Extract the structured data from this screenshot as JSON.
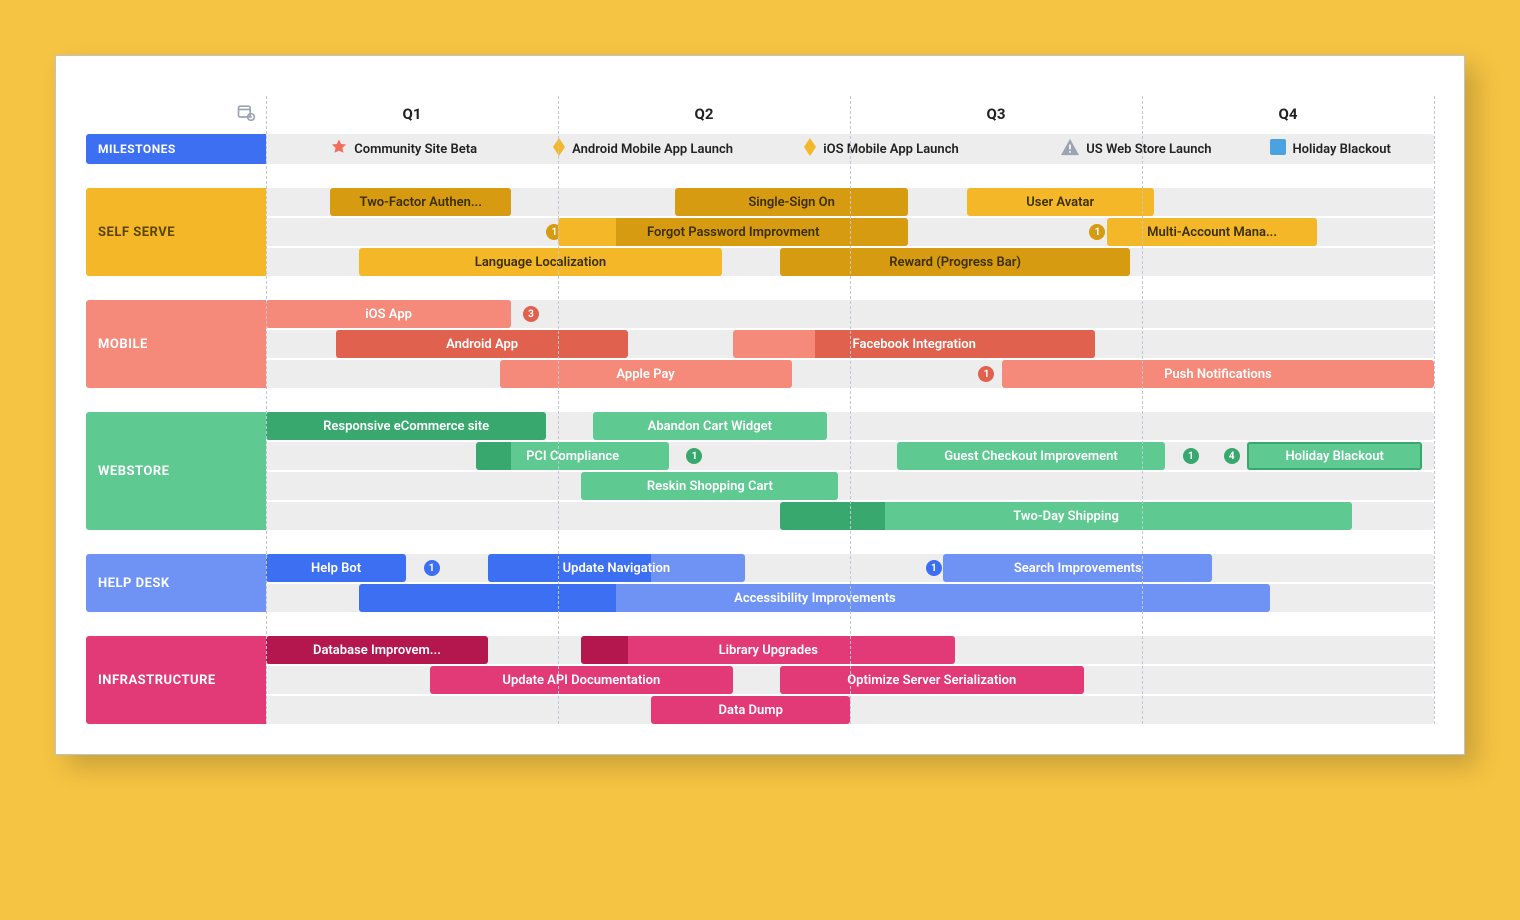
{
  "quarters": [
    "Q1",
    "Q2",
    "Q3",
    "Q4"
  ],
  "milestones_label": "MILESTONES",
  "milestones": [
    {
      "label": "Community Site Beta",
      "icon": "star",
      "pos": 5.5
    },
    {
      "label": "Android Mobile App Launch",
      "icon": "diamond",
      "pos": 24.5
    },
    {
      "label": "iOS Mobile App Launch",
      "icon": "diamond",
      "pos": 46
    },
    {
      "label": "US Web Store Launch",
      "icon": "warn",
      "pos": 68
    },
    {
      "label": "Holiday Blackout",
      "icon": "square",
      "pos": 86
    }
  ],
  "categories": [
    {
      "key": "ss",
      "label": "SELF SERVE",
      "class": "cat-ss",
      "lanes": [
        [
          {
            "label": "Two-Factor Authen...",
            "start": 5.5,
            "end": 21,
            "variant": "d",
            "text": "t-dark"
          },
          {
            "label": "Single-Sign On",
            "start": 35,
            "end": 55,
            "variant": "d",
            "text": "t-dark"
          },
          {
            "label": "User Avatar",
            "start": 60,
            "end": 76,
            "variant": "",
            "text": "t-dark"
          }
        ],
        [
          {
            "badge": "1",
            "at": 24,
            "bcolor": "#d69b10"
          },
          {
            "label": "Forgot Password Improvment",
            "start": 25,
            "end": 55,
            "variant": "d",
            "text": "t-dark",
            "prefill": {
              "start": 25,
              "end": 30,
              "color": "#f4b728"
            }
          },
          {
            "badge": "1",
            "at": 70.5,
            "bcolor": "#d69b10"
          },
          {
            "label": "Multi-Account Mana...",
            "start": 72,
            "end": 90,
            "variant": "",
            "text": "t-dark"
          }
        ],
        [
          {
            "label": "Language Localization",
            "start": 8,
            "end": 39,
            "variant": "",
            "text": "t-dark"
          },
          {
            "label": "Reward (Progress Bar)",
            "start": 44,
            "end": 74,
            "variant": "d",
            "text": "t-dark"
          }
        ]
      ]
    },
    {
      "key": "mb",
      "label": "MOBILE",
      "class": "cat-mb",
      "lanes": [
        [
          {
            "label": "iOS App",
            "start": 0,
            "end": 21,
            "variant": "",
            "text": ""
          },
          {
            "badge": "3",
            "at": 22,
            "bcolor": "#e0614e"
          }
        ],
        [
          {
            "label": "Android App",
            "start": 6,
            "end": 31,
            "variant": "d",
            "text": ""
          },
          {
            "label": "Facebook Integration",
            "start": 40,
            "end": 71,
            "variant": "d",
            "text": "",
            "prefill": {
              "start": 40,
              "end": 47,
              "color": "#f58a7a"
            }
          }
        ],
        [
          {
            "label": "Apple Pay",
            "start": 20,
            "end": 45,
            "variant": "",
            "text": ""
          },
          {
            "badge": "1",
            "at": 61,
            "bcolor": "#e0614e"
          },
          {
            "label": "Push Notifications",
            "start": 63,
            "end": 100,
            "variant": "",
            "text": ""
          }
        ]
      ]
    },
    {
      "key": "ws",
      "label": "WEBSTORE",
      "class": "cat-ws",
      "lanes": [
        [
          {
            "label": "Responsive eCommerce site",
            "start": 0,
            "end": 24,
            "variant": "d",
            "text": ""
          },
          {
            "label": "Abandon Cart Widget",
            "start": 28,
            "end": 48,
            "variant": "",
            "text": ""
          }
        ],
        [
          {
            "label": "PCI Compliance",
            "start": 18,
            "end": 34.5,
            "variant": "",
            "text": "",
            "prefill": {
              "start": 18,
              "end": 21,
              "color": "#39a86e"
            }
          },
          {
            "badge": "1",
            "at": 36,
            "bcolor": "#39a86e"
          },
          {
            "label": "Guest Checkout Improvement",
            "start": 54,
            "end": 77,
            "variant": "",
            "text": ""
          },
          {
            "badge": "1",
            "at": 78.5,
            "bcolor": "#39a86e"
          },
          {
            "badge": "4",
            "at": 82,
            "bcolor": "#39a86e"
          },
          {
            "label": "Holiday Blackout",
            "start": 84,
            "end": 99,
            "variant": "",
            "text": "",
            "border": "#39a86e"
          }
        ],
        [
          {
            "label": "Reskin Shopping Cart",
            "start": 27,
            "end": 49,
            "variant": "",
            "text": ""
          }
        ],
        [
          {
            "label": "Two-Day Shipping",
            "start": 44,
            "end": 93,
            "variant": "",
            "text": "",
            "prefill": {
              "start": 44,
              "end": 53,
              "color": "#39a86e"
            }
          }
        ]
      ]
    },
    {
      "key": "hd",
      "label": "HELP DESK",
      "class": "cat-hd",
      "lanes": [
        [
          {
            "label": "Help Bot",
            "start": 0,
            "end": 12,
            "variant": "d",
            "text": ""
          },
          {
            "badge": "1",
            "at": 13.5,
            "bcolor": "#3d6ff2"
          },
          {
            "label": "Update Navigation",
            "start": 19,
            "end": 41,
            "variant": "",
            "text": "",
            "prefill": {
              "start": 19,
              "end": 33,
              "color": "#3d6ff2"
            }
          },
          {
            "badge": "1",
            "at": 56.5,
            "bcolor": "#3d6ff2"
          },
          {
            "label": "Search Improvements",
            "start": 58,
            "end": 81,
            "variant": "",
            "text": ""
          }
        ],
        [
          {
            "label": "Accessibility Improvements",
            "start": 8,
            "end": 86,
            "variant": "",
            "text": "",
            "prefill": {
              "start": 8,
              "end": 30,
              "color": "#3d6ff2"
            }
          }
        ]
      ]
    },
    {
      "key": "if",
      "label": "INFRASTRUCTURE",
      "class": "cat-if",
      "lanes": [
        [
          {
            "label": "Database Improvem...",
            "start": 0,
            "end": 19,
            "variant": "d",
            "text": ""
          },
          {
            "label": "Library Upgrades",
            "start": 27,
            "end": 59,
            "variant": "",
            "text": "",
            "prefill": {
              "start": 27,
              "end": 31,
              "color": "#b3174e"
            }
          }
        ],
        [
          {
            "label": "Update API Documentation",
            "start": 14,
            "end": 40,
            "variant": "",
            "text": ""
          },
          {
            "label": "Optimize Server Serialization",
            "start": 44,
            "end": 70,
            "variant": "",
            "text": ""
          }
        ],
        [
          {
            "label": "Data Dump",
            "start": 33,
            "end": 50,
            "variant": "",
            "text": ""
          }
        ]
      ]
    }
  ]
}
